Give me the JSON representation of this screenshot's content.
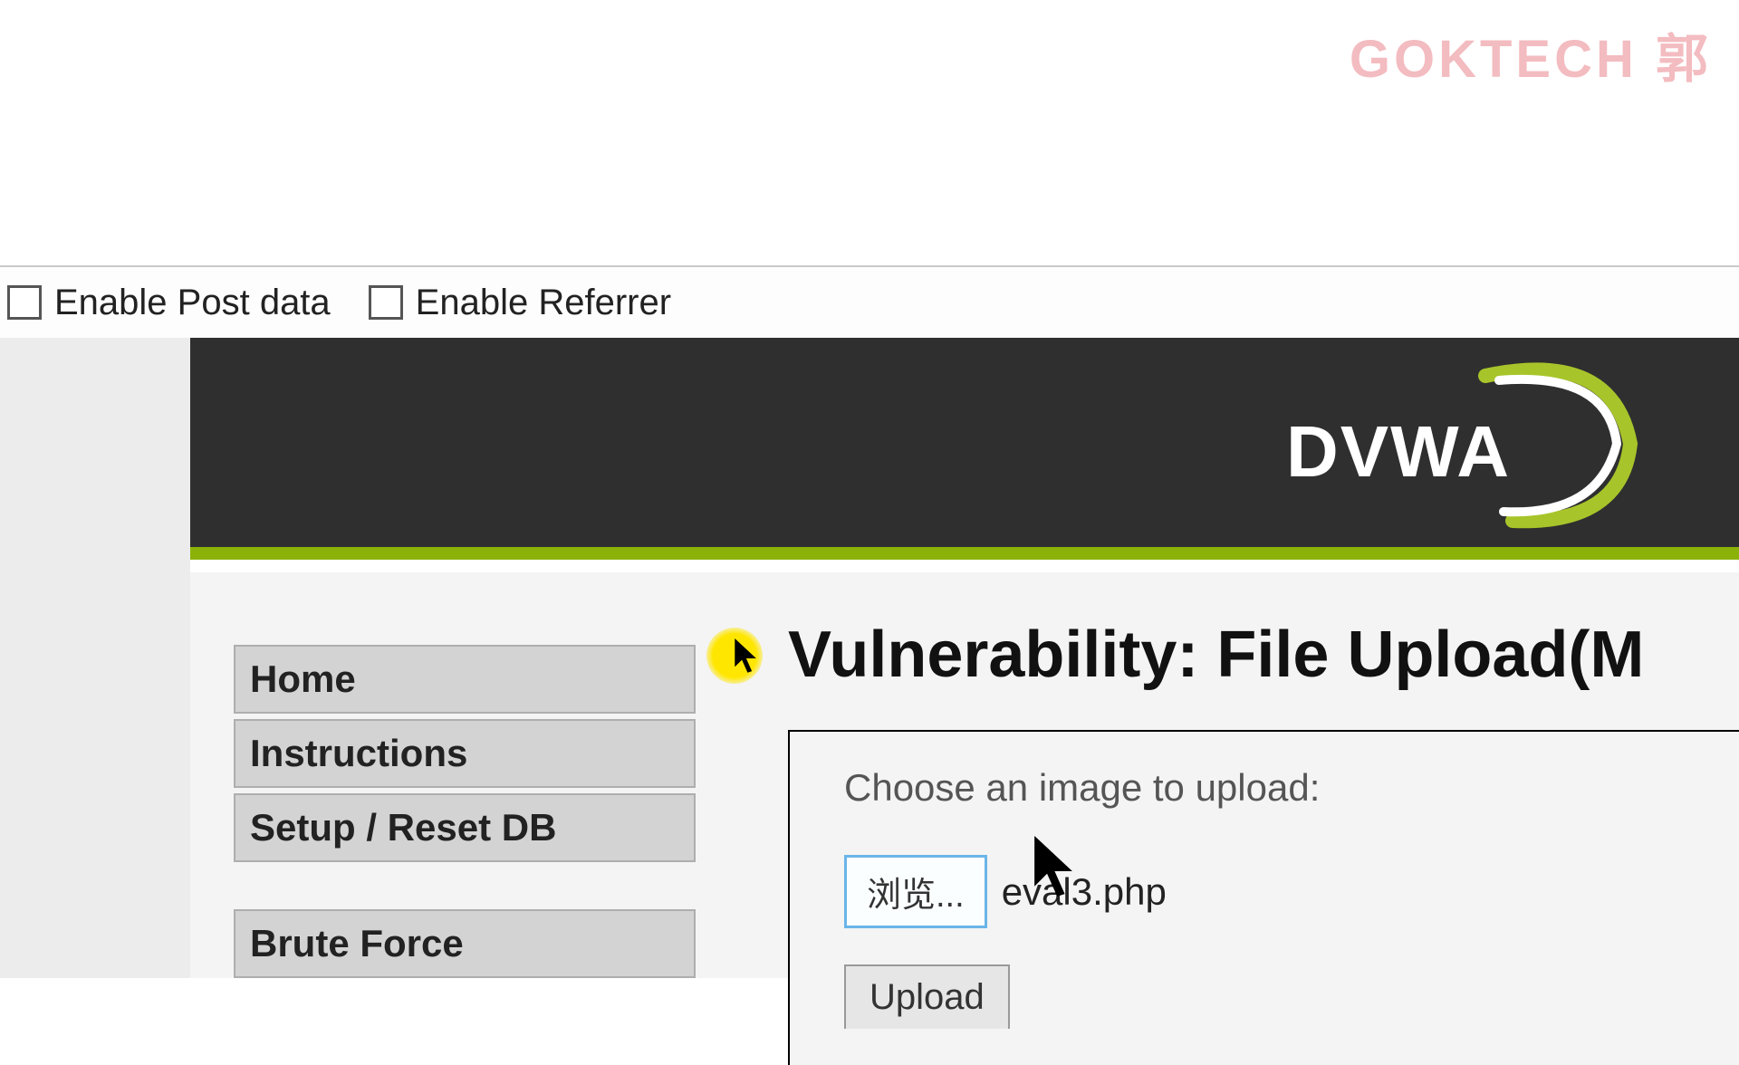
{
  "watermark": "GOKTECH  郭",
  "toolbar": {
    "enable_post": "Enable Post data",
    "enable_referrer": "Enable Referrer"
  },
  "logo_text": "DVWA",
  "sidebar": {
    "items": [
      {
        "label": "Home"
      },
      {
        "label": "Instructions"
      },
      {
        "label": "Setup / Reset DB"
      },
      {
        "label": "Brute Force"
      }
    ]
  },
  "main": {
    "title": "Vulnerability: File Upload(M",
    "prompt": "Choose an image to upload:",
    "browse_label": "浏览...",
    "selected_file": "eval3.php",
    "upload_label": "Upload"
  }
}
